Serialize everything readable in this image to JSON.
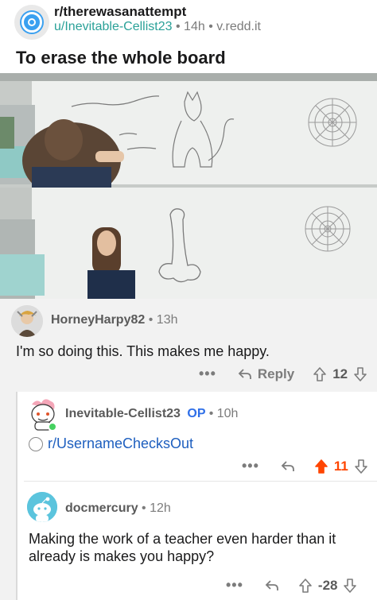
{
  "post": {
    "subreddit": "r/therewasanattempt",
    "author": "u/Inevitable-Cellist23",
    "age": "14h",
    "domain": "v.redd.it",
    "separator": "•",
    "title": "To erase the whole board"
  },
  "comments": [
    {
      "user": "HorneyHarpy82",
      "age": "13h",
      "body": "I'm so doing this.  This makes me happy.",
      "more": "•••",
      "reply_label": "Reply",
      "score": "12"
    },
    {
      "user": "Inevitable-Cellist23",
      "badge": "OP",
      "age": "10h",
      "link_text": "r/UsernameChecksOut",
      "more": "•••",
      "score": "11",
      "upvoted": true
    },
    {
      "user": "docmercury",
      "age": "12h",
      "body": "Making the work of a teacher even harder than it already is makes you happy?",
      "more": "•••",
      "score": "-28"
    }
  ],
  "colors": {
    "username_teal": "#2aa198",
    "upvote_orange": "#ff4500",
    "op_blue": "#2f6fe8",
    "link_blue": "#1e5fbf",
    "muted": "#7c7c7c"
  },
  "icons": {
    "subreddit_avatar": "subreddit-icon",
    "reply": "reply-arrow-icon",
    "upvote": "upvote-arrow-icon",
    "downvote": "downvote-arrow-icon",
    "more": "more-options-icon",
    "online": "online-status-icon"
  }
}
